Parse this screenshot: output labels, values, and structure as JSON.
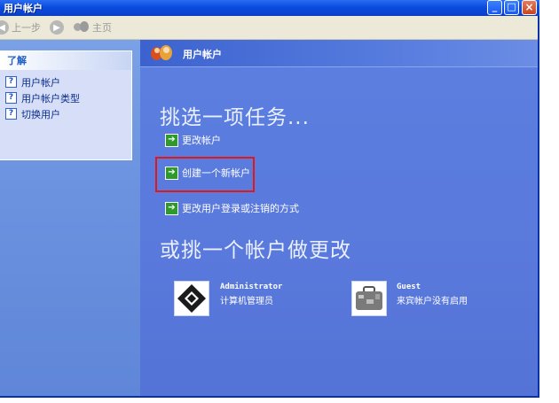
{
  "window": {
    "title": "用户帐户",
    "controls": {
      "minimize": "_",
      "maximize": "□",
      "close": "×"
    }
  },
  "toolbar": {
    "back_label": "上一步",
    "home_label": "主页",
    "back_icon": "back-arrow-icon",
    "forward_icon": "forward-arrow-icon",
    "home_icon": "users-home-icon"
  },
  "sidebar": {
    "learn_title": "了解",
    "items": [
      {
        "label": "用户帐户",
        "icon": "help-icon"
      },
      {
        "label": "用户帐户类型",
        "icon": "help-icon"
      },
      {
        "label": "切换用户",
        "icon": "help-icon"
      }
    ]
  },
  "main": {
    "header_title": "用户帐户",
    "task_heading": "挑选一项任务...",
    "tasks": [
      {
        "label": "更改帐户"
      },
      {
        "label": "创建一个新帐户"
      },
      {
        "label": "更改用户登录或注销的方式"
      }
    ],
    "account_heading": "或挑一个帐户做更改",
    "accounts": [
      {
        "name": "Administrator",
        "desc": "计算机管理员",
        "icon": "administrator-picture-icon"
      },
      {
        "name": "Guest",
        "desc": "来宾帐户没有启用",
        "icon": "guest-briefcase-icon"
      }
    ]
  },
  "colors": {
    "title_bar": "#0b4be0",
    "main_bg": "#5a79dc",
    "sidebar_bg": "#6b93df",
    "highlight_border": "#e01818",
    "task_arrow": "#2e9a2c"
  }
}
